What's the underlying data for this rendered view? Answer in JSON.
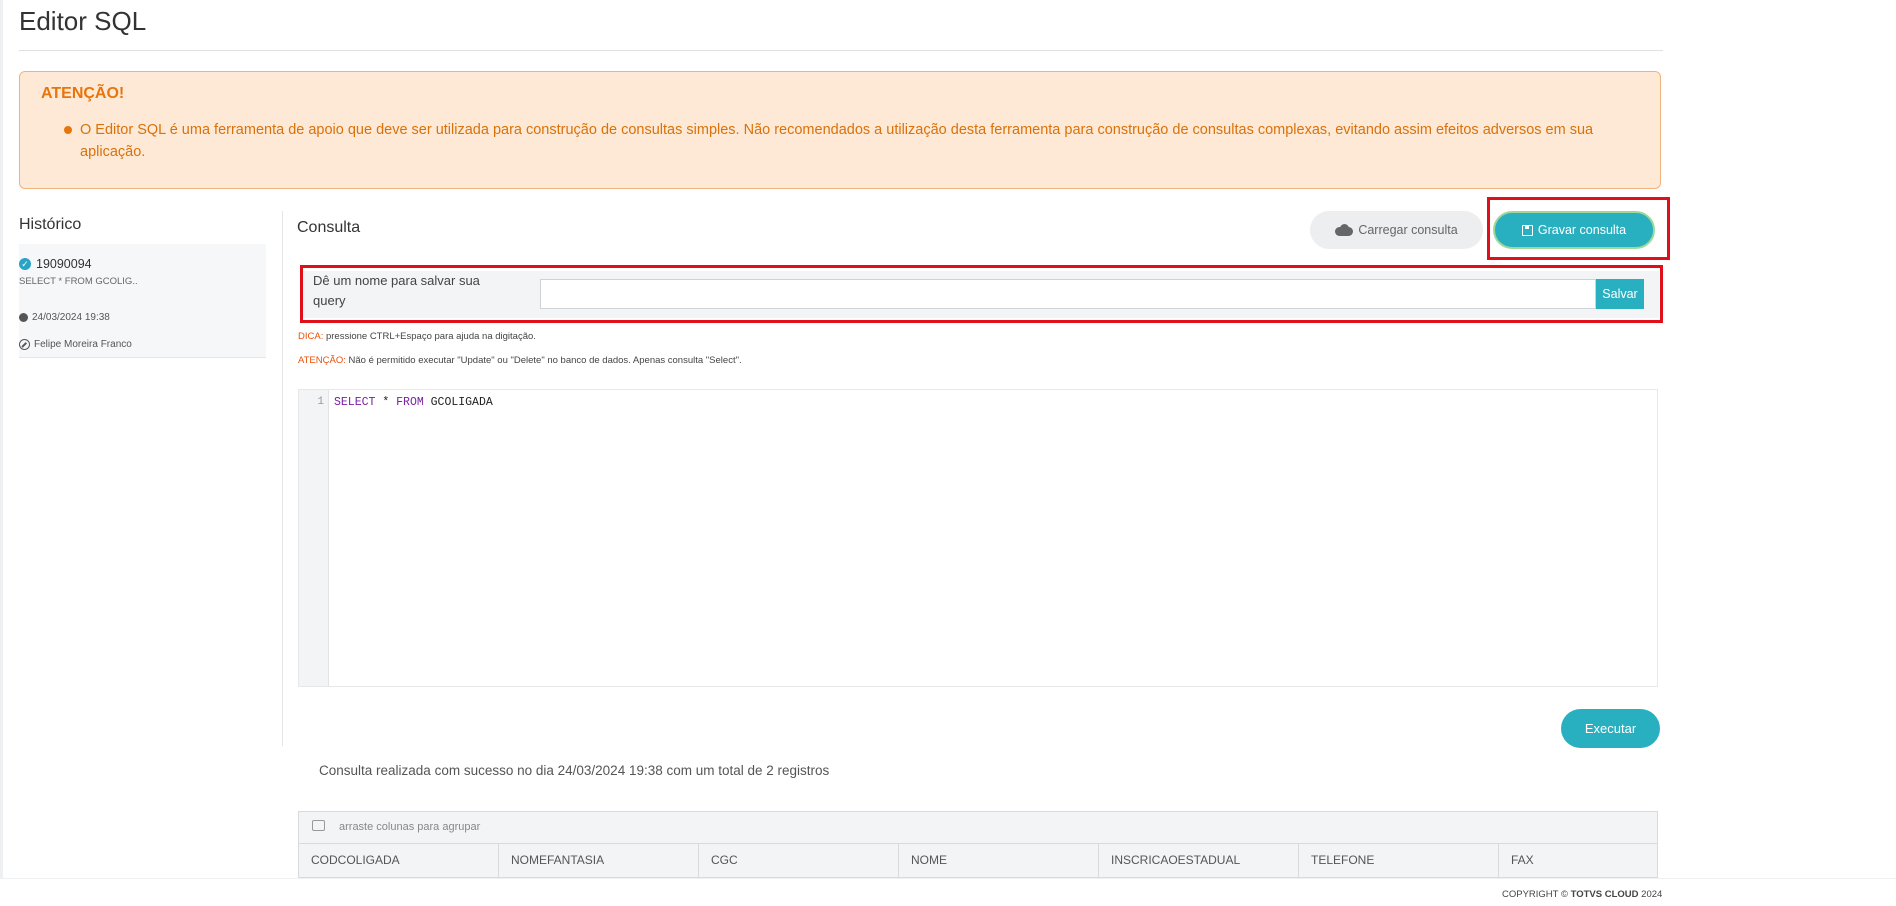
{
  "page": {
    "title": "Editor SQL"
  },
  "alert": {
    "title": "ATENÇÃO!",
    "message": "O Editor SQL é uma ferramenta de apoio que deve ser utilizada para construção de consultas simples. Não recomendados a utilização desta ferramenta para construção de consultas complexas, evitando assim efeitos adversos em sua aplicação."
  },
  "history": {
    "title": "Histórico",
    "item": {
      "id": "19090094",
      "query": "SELECT * FROM GCOLIG..",
      "datetime": "24/03/2024 19:38",
      "user": "Felipe Moreira Franco"
    }
  },
  "query_panel": {
    "title": "Consulta",
    "load_button": "Carregar consulta",
    "save_button": "Gravar consulta",
    "name_label": "Dê um nome para salvar sua query",
    "name_value": "",
    "salvar_button": "Salvar",
    "tip_label": "DICA:",
    "tip_text": " pressione CTRL+Espaço para ajuda na digitação.",
    "warning_label": "ATENÇÃO:",
    "warning_text": " Não é permitido executar \"Update\" ou \"Delete\" no banco de dados. Apenas consulta \"Select\"."
  },
  "editor": {
    "line_number": "1",
    "tokens": {
      "kw1": "SELECT",
      "star": " * ",
      "kw2": "FROM",
      "table": " GCOLIGADA"
    }
  },
  "execute_button": "Executar",
  "result_message": "Consulta realizada com sucesso no dia 24/03/2024 19:38 com um total de 2 registros",
  "grid": {
    "group_hint": "arraste colunas para agrupar",
    "columns": [
      "CODCOLIGADA",
      "NOMEFANTASIA",
      "CGC",
      "NOME",
      "INSCRICAOESTADUAL",
      "TELEFONE",
      "FAX"
    ]
  },
  "footer": {
    "prefix": "COPYRIGHT © ",
    "brand": "TOTVS CLOUD",
    "year": " 2024"
  },
  "colors": {
    "accent": "#29b0c0",
    "warning": "#e8750c",
    "highlight": "#e0101a"
  }
}
